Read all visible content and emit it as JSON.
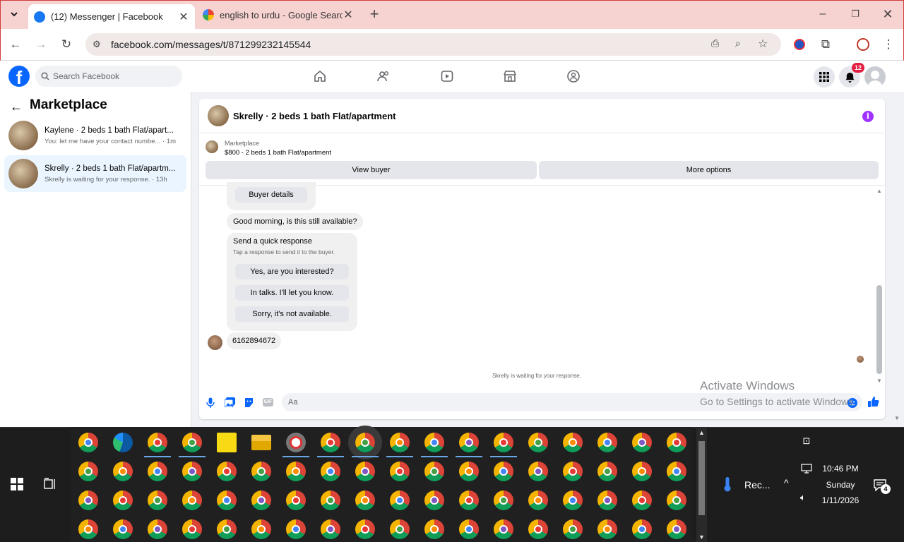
{
  "browser": {
    "tabs": [
      {
        "title": "(12) Messenger | Facebook",
        "active": true
      },
      {
        "title": "english to urdu - Google Search",
        "active": false
      }
    ],
    "url": "facebook.com/messages/t/871299232145544",
    "window_controls": [
      "minimize",
      "restore",
      "close"
    ]
  },
  "facebook": {
    "search_placeholder": "Search Facebook",
    "notifications_count": "12",
    "nav_icons": [
      "home-icon",
      "friends-icon",
      "video-icon",
      "marketplace-icon",
      "groups-icon"
    ]
  },
  "sidebar": {
    "title": "Marketplace",
    "conversations": [
      {
        "name": "Kaylene · 2 beds 1 bath Flat/apart...",
        "preview": "You: let me have your contact numbe... · 1m"
      },
      {
        "name": "Skrelly · 2 beds 1 bath Flat/apartm...",
        "preview": "Skrelly is waiting for your response. · 13h",
        "selected": true
      }
    ]
  },
  "chat": {
    "title": "Skrelly · 2 beds 1 bath Flat/apartment",
    "listing_source": "Marketplace",
    "listing_title": "$800 - 2 beds 1 bath Flat/apartment",
    "view_buyer": "View buyer",
    "more_options": "More options",
    "buyer_details": "Buyer details",
    "message1": "Good morning, is this still available?",
    "quick_title": "Send a quick response",
    "quick_subtitle": "Tap a response to send it to the buyer.",
    "quick_responses": [
      "Yes, are you interested?",
      "In talks. I'll let you know.",
      "Sorry, it's not available."
    ],
    "message2": "6162894672",
    "status": "Skrelly is waiting for your response.",
    "input_placeholder": "Aa",
    "gif_label": "GIF"
  },
  "watermark": {
    "line1": "Activate Windows",
    "line2": "Go to Settings to activate Windows."
  },
  "taskbar": {
    "weather_label": "Rec...",
    "time": "10:46 PM",
    "day": "Sunday",
    "date": "1/11/2026",
    "notification_count": "4"
  },
  "colors": {
    "facebook_blue": "#0866ff",
    "tabstrip": "#f6d3d0",
    "purple_info": "#a033ff",
    "badge_red": "#e41e3f"
  }
}
